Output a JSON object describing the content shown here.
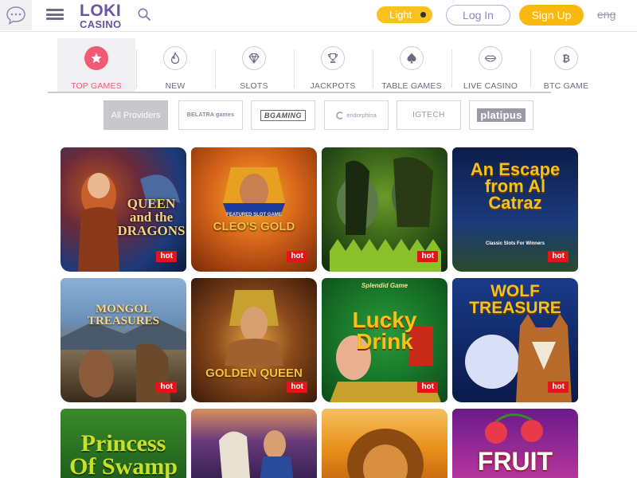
{
  "header": {
    "logo_line1": "LOKI",
    "logo_line2": "CASINO",
    "theme_label": "Light",
    "login_label": "Log In",
    "signup_label": "Sign Up",
    "language": "eng",
    "icons": [
      "chat-bubble-icon",
      "hamburger-menu-icon",
      "search-icon"
    ]
  },
  "categories": [
    {
      "label": "TOP GAMES",
      "icon": "star-icon",
      "active": true
    },
    {
      "label": "NEW",
      "icon": "flame-icon",
      "active": false
    },
    {
      "label": "SLOTS",
      "icon": "diamond-icon",
      "active": false
    },
    {
      "label": "JACKPOTS",
      "icon": "trophy-icon",
      "active": false
    },
    {
      "label": "TABLE GAMES",
      "icon": "spade-icon",
      "active": false
    },
    {
      "label": "LIVE CASINO",
      "icon": "lips-icon",
      "active": false
    },
    {
      "label": "BTC GAME",
      "icon": "bitcoin-icon",
      "active": false
    }
  ],
  "providers": [
    {
      "label": "All Providers",
      "active": true
    },
    {
      "label": "BELATRA games"
    },
    {
      "label": "BGAMING"
    },
    {
      "label": "endorphina"
    },
    {
      "label": "IGTECH"
    },
    {
      "label": "platipus"
    }
  ],
  "games": [
    {
      "title": "QUEEN and the DRAGONS",
      "badge": "hot",
      "colors": [
        "#1d3a7a",
        "#3c2a6e",
        "#b8531e"
      ]
    },
    {
      "title": "FEATURED SLOT GAME",
      "title2": "CLEO'S GOLD",
      "badge": "hot",
      "colors": [
        "#7a2a06",
        "#d8661a",
        "#f5b22a"
      ]
    },
    {
      "title": "",
      "badge": "hot",
      "colors": [
        "#0f2a10",
        "#3f6a1a",
        "#6b9b2a"
      ]
    },
    {
      "title": "An Escape from Al Catraz",
      "subtitle": "Classic Slots For Winners",
      "badge": "hot",
      "colors": [
        "#0d1d4a",
        "#1b3a7a",
        "#f2c21a"
      ]
    },
    {
      "title": "MONGOL TREASURES",
      "badge": "hot",
      "colors": [
        "#6a8fb8",
        "#7a5a3a",
        "#3a2a1a"
      ]
    },
    {
      "title": "GOLDEN QUEEN",
      "badge": "hot",
      "colors": [
        "#3a1a0a",
        "#8a4a1a",
        "#e0a040"
      ]
    },
    {
      "title": "Splendid Game",
      "title2": "Lucky Drink",
      "badge": "hot",
      "colors": [
        "#0c4a1a",
        "#1a7a2a",
        "#f5c21a"
      ]
    },
    {
      "title": "WOLF TREASURE",
      "badge": "hot",
      "colors": [
        "#0a1a4a",
        "#1a3a8a",
        "#f5c21a"
      ]
    },
    {
      "title": "Princess Of Swamp",
      "colors": [
        "#1a5a1a",
        "#3a8a2a",
        "#c8e02a"
      ]
    },
    {
      "title": "",
      "colors": [
        "#2a1a4a",
        "#6a3a7a",
        "#d89060"
      ]
    },
    {
      "title": "",
      "colors": [
        "#c06010",
        "#e8901a",
        "#f5c060"
      ]
    },
    {
      "title": "FRUIT",
      "colors": [
        "#6a1a8a",
        "#c03aa0",
        "#e83a4a"
      ]
    }
  ]
}
